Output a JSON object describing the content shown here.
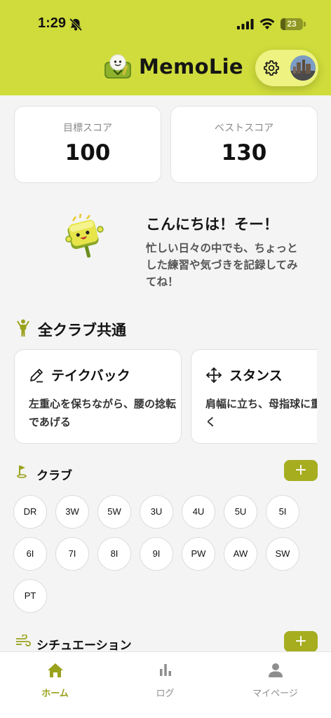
{
  "status_bar": {
    "time": "1:29",
    "battery": "23",
    "battery_level": 0.23
  },
  "header": {
    "app_title": "MemoLie"
  },
  "scores": {
    "target": {
      "label": "目標スコア",
      "value": "100"
    },
    "best": {
      "label": "ベストスコア",
      "value": "130"
    }
  },
  "greeting": {
    "title": "こんにちは！そー！",
    "message": "忙しい日々の中でも、ちょっとした練習や気づきを記録してみてね！"
  },
  "common_section": {
    "title": "全クラブ共通",
    "tips": [
      {
        "icon": "pencil-icon",
        "title": "テイクバック",
        "body": "左重心を保ちながら、腰の捻転であげる"
      },
      {
        "icon": "move-arrows-icon",
        "title": "スタンス",
        "body": "肩幅に立ち、母指球に重心を置く"
      }
    ]
  },
  "clubs_section": {
    "title": "クラブ",
    "add_label": "+",
    "clubs": [
      "DR",
      "3W",
      "5W",
      "3U",
      "4U",
      "5U",
      "5I",
      "6I",
      "7I",
      "8I",
      "9I",
      "PW",
      "AW",
      "SW",
      "PT"
    ]
  },
  "situation_section": {
    "title": "シチュエーション",
    "add_label": "+"
  },
  "bottom_nav": {
    "items": [
      {
        "label": "ホーム",
        "icon": "home-icon",
        "active": true
      },
      {
        "label": "ログ",
        "icon": "bar-chart-icon",
        "active": false
      },
      {
        "label": "マイページ",
        "icon": "person-icon",
        "active": false
      }
    ]
  },
  "colors": {
    "header_bg": "#cfdc3b",
    "accent": "#a6ad1f",
    "pill_bg": "#eef280",
    "page_bg": "#f4f4f4"
  }
}
